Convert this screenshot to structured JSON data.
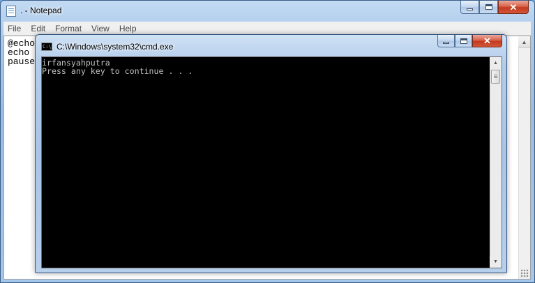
{
  "notepad": {
    "title": ". - Notepad",
    "menu": [
      "File",
      "Edit",
      "Format",
      "View",
      "Help"
    ],
    "lines": [
      "@echo",
      "echo",
      "pause"
    ],
    "icon": "notepad-icon"
  },
  "cmd": {
    "title": "C:\\Windows\\system32\\cmd.exe",
    "icon_text": "C:\\",
    "output": [
      "irfansyahputra",
      "Press any key to continue . . ."
    ],
    "colors": {
      "background": "#000000",
      "text": "#c0c0c0"
    }
  },
  "caption_buttons": {
    "minimize": "minimize-icon",
    "maximize": "maximize-icon",
    "close": "close-icon"
  }
}
